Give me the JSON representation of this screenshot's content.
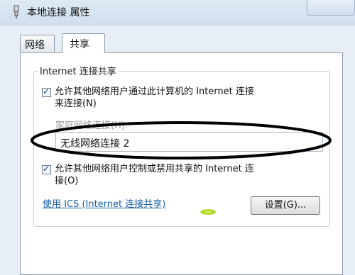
{
  "window": {
    "title": "本地连接 属性"
  },
  "tabs": [
    {
      "label": "网络",
      "active": false
    },
    {
      "label": "共享",
      "active": true
    }
  ],
  "sharing": {
    "group_label": "Internet 连接共享",
    "allow_connect": {
      "checked": true,
      "line1": "允许其他网络用户通过此计算机的 Internet 连接",
      "line2": "来连接(N)"
    },
    "home_network": {
      "label": "家庭网络连接(H):",
      "value": "无线网络连接 2"
    },
    "allow_control": {
      "checked": true,
      "line1": "允许其他网络用户控制或禁用共享的 Internet 连",
      "line2": "接(O)"
    },
    "ics_link": "使用 ICS (Internet 连接共享)",
    "settings_button": "设置(G)..."
  },
  "colors": {
    "link": "#1a5fa8",
    "annotation_ellipse": "#000000"
  }
}
